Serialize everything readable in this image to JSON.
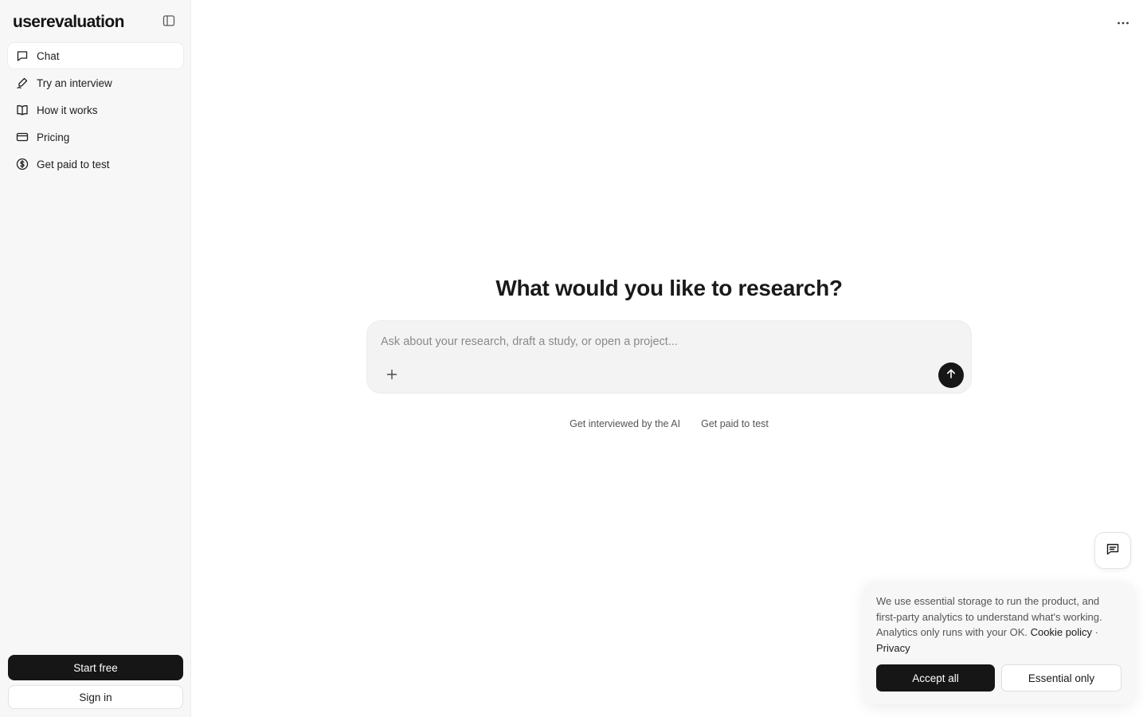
{
  "app": {
    "logo": "userevaluation"
  },
  "sidebar": {
    "items": [
      {
        "label": "Chat",
        "icon": "chat-bubble-icon",
        "active": true
      },
      {
        "label": "Try an interview",
        "icon": "pen-icon",
        "active": false
      },
      {
        "label": "How it works",
        "icon": "book-icon",
        "active": false
      },
      {
        "label": "Pricing",
        "icon": "credit-card-icon",
        "active": false
      },
      {
        "label": "Get paid to test",
        "icon": "dollar-circle-icon",
        "active": false
      }
    ],
    "start_label": "Start free",
    "signin_label": "Sign in"
  },
  "main": {
    "headline": "What would you like to research?",
    "composer_placeholder": "Ask about your research, draft a study, or open a project...",
    "links": {
      "interview": "Get interviewed by the AI",
      "paid": "Get paid to test"
    }
  },
  "cookie": {
    "text": "We use essential storage to run the product, and first-party analytics to understand what's working. Analytics only runs with your OK.",
    "policy_link": "Cookie policy",
    "separator": "·",
    "privacy_link": "Privacy",
    "accept_label": "Accept all",
    "essential_label": "Essential only"
  },
  "colors": {
    "sidebar_bg": "#f7f7f7",
    "primary_button": "#161616",
    "composer_bg": "#f3f3f3"
  }
}
